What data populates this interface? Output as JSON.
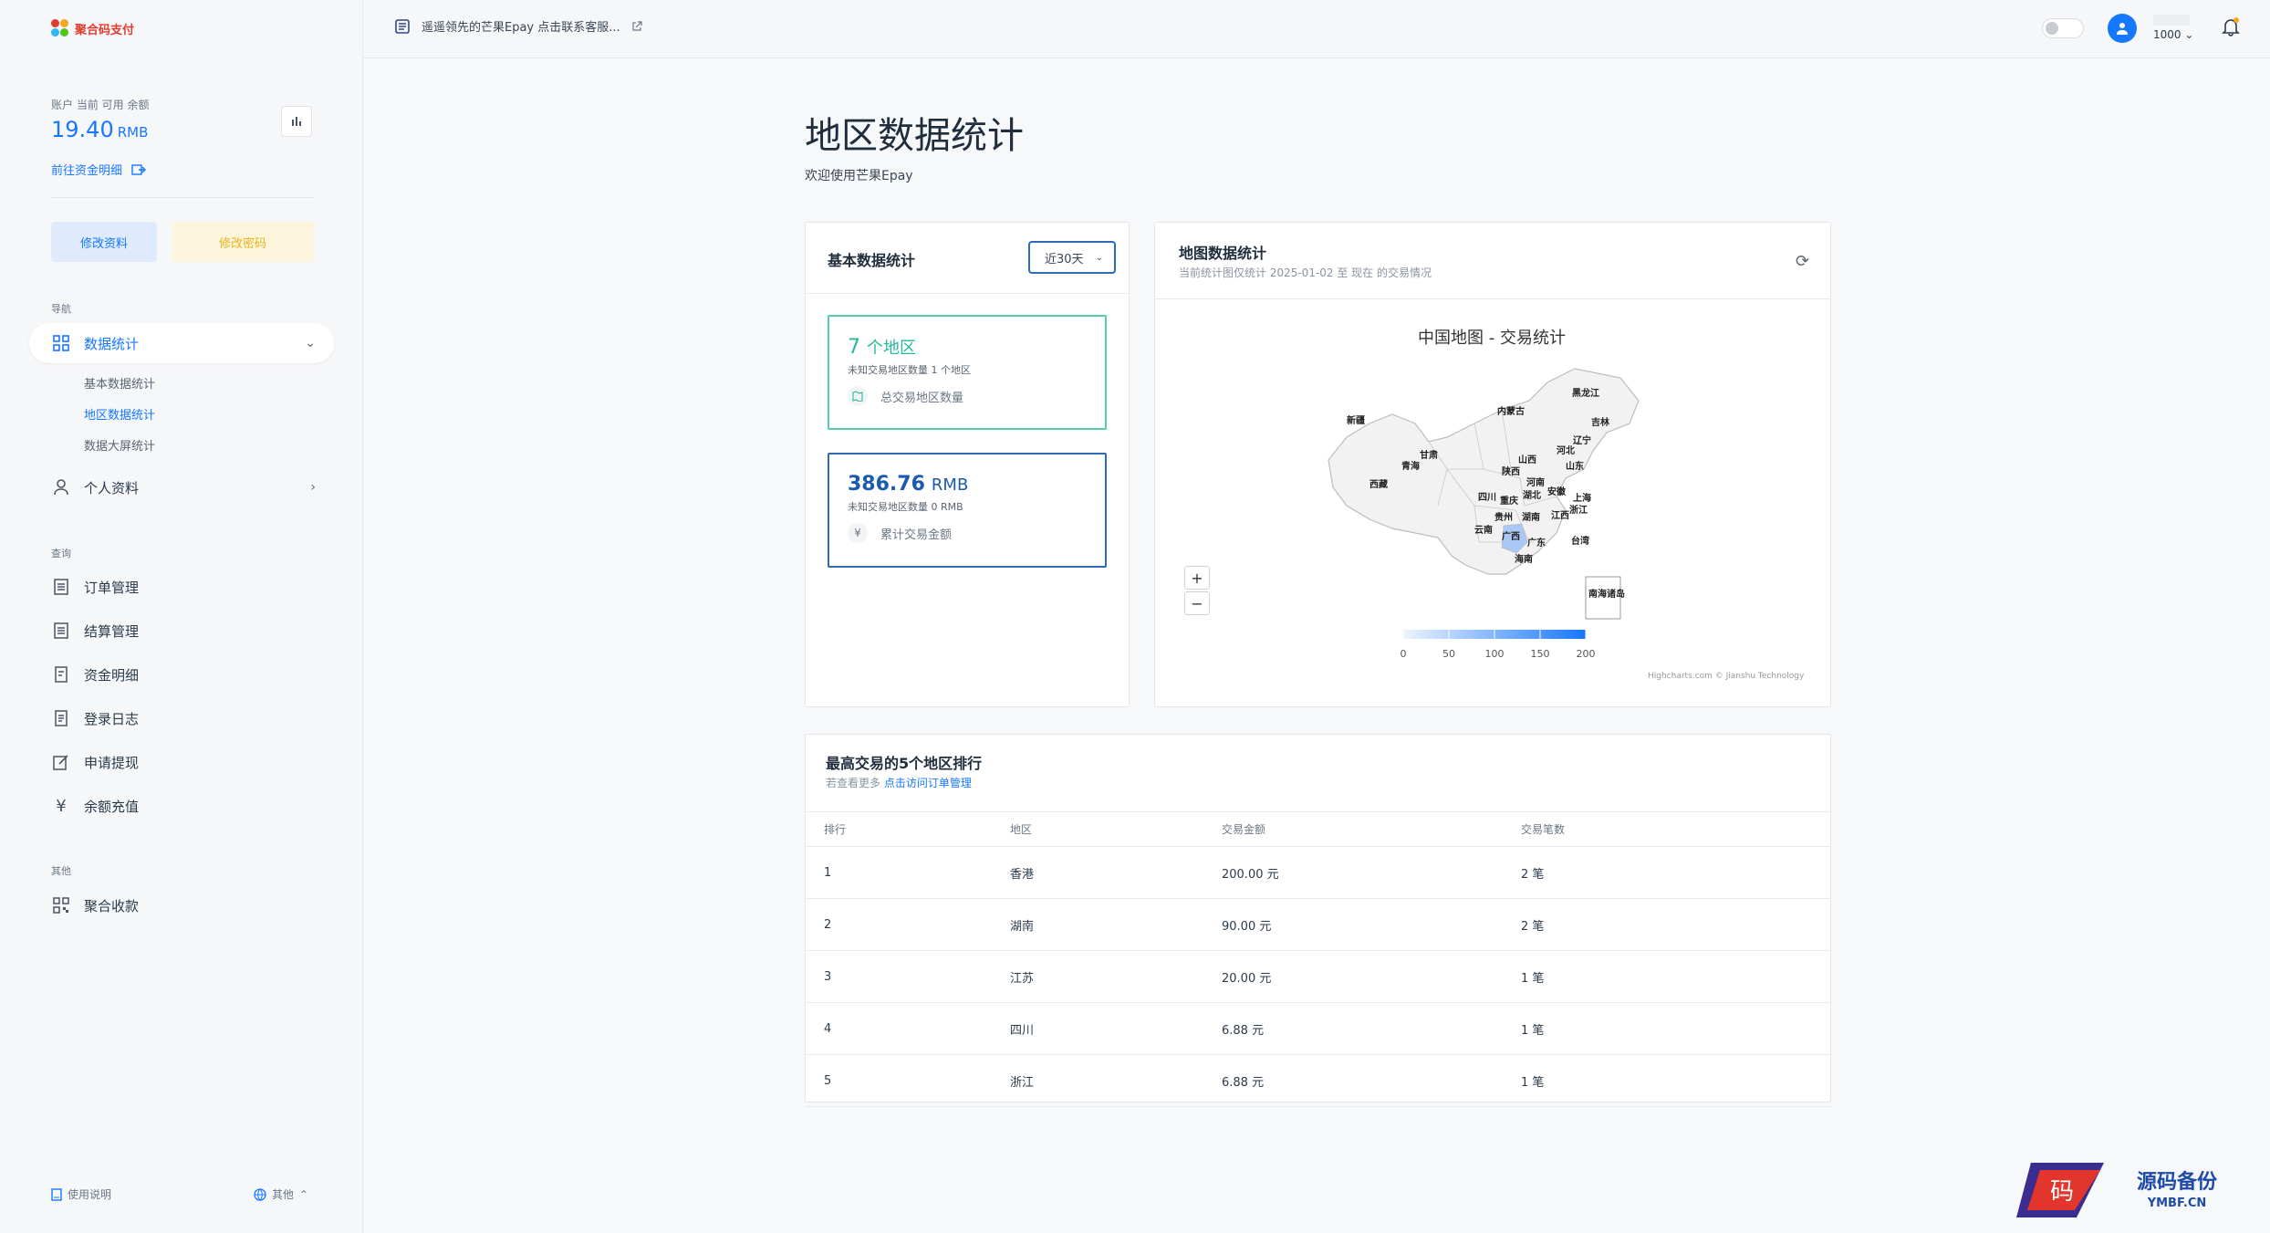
{
  "brand": {
    "name": "聚合码支付"
  },
  "sidebar": {
    "balance_caption": "账户 当前 可用 余额",
    "balance_value": "19.40",
    "balance_unit": "RMB",
    "fund_link": "前往资金明细",
    "btn_profile": "修改资料",
    "btn_password": "修改密码",
    "section_nav": "导航",
    "section_query": "查询",
    "section_other": "其他",
    "nav_stats": "数据统计",
    "sub_basic": "基本数据统计",
    "sub_region": "地区数据统计",
    "sub_screen": "数据大屏统计",
    "nav_profile": "个人资料",
    "nav_orders": "订单管理",
    "nav_settle": "结算管理",
    "nav_funds": "资金明细",
    "nav_login_log": "登录日志",
    "nav_withdraw": "申请提现",
    "nav_recharge": "余额充值",
    "nav_aggregate": "聚合收款",
    "foot_help": "使用说明",
    "foot_lang": "其他"
  },
  "topbar": {
    "notice": "遥遥领先的芒果Epay 点击联系客服...",
    "user_name": "1000"
  },
  "page": {
    "title": "地区数据统计",
    "subtitle": "欢迎使用芒果Epay"
  },
  "basic_card": {
    "title": "基本数据统计",
    "range": "近30天",
    "box1_value": "7",
    "box1_unit": "个地区",
    "box1_line": "未知交易地区数量 1 个地区",
    "box1_foot": "总交易地区数量",
    "box2_value": "386.76",
    "box2_unit": "RMB",
    "box2_line": "未知交易地区数量 0 RMB",
    "box2_foot": "累计交易金额",
    "currency_symbol": "¥"
  },
  "map_card": {
    "title": "地图数据统计",
    "subtitle": "当前统计图仅统计 2025-01-02 至 现在 的交易情况",
    "map_title": "中国地图 - 交易统计",
    "zoom_in": "+",
    "zoom_out": "−",
    "legend_ticks": [
      "0",
      "50",
      "100",
      "150",
      "200"
    ],
    "credits": "Highcharts.com © Jianshu Technology",
    "province_labels": [
      {
        "name": "黑龙江"
      },
      {
        "name": "吉林"
      },
      {
        "name": "辽宁"
      },
      {
        "name": "内蒙古"
      },
      {
        "name": "新疆"
      },
      {
        "name": "甘肃"
      },
      {
        "name": "青海"
      },
      {
        "name": "河北"
      },
      {
        "name": "山西"
      },
      {
        "name": "山东"
      },
      {
        "name": "陕西"
      },
      {
        "name": "河南"
      },
      {
        "name": "西藏"
      },
      {
        "name": "四川"
      },
      {
        "name": "重庆"
      },
      {
        "name": "湖北"
      },
      {
        "name": "安徽"
      },
      {
        "name": "上海"
      },
      {
        "name": "浙江"
      },
      {
        "name": "江西"
      },
      {
        "name": "湖南"
      },
      {
        "name": "贵州"
      },
      {
        "name": "云南"
      },
      {
        "name": "广西"
      },
      {
        "name": "广东"
      },
      {
        "name": "台湾"
      },
      {
        "name": "海南"
      },
      {
        "name": "南海诸岛"
      }
    ],
    "colors": {
      "low": "#eef4fe",
      "high": "#1677ff"
    }
  },
  "chart_data": {
    "type": "heatmap",
    "title": "中国地图 - 交易统计",
    "color_axis": [
      0,
      200
    ],
    "regions": [
      "香港",
      "湖南",
      "江苏",
      "四川",
      "浙江"
    ],
    "values": [
      200.0,
      90.0,
      20.0,
      6.88,
      6.88
    ]
  },
  "rank_card": {
    "title": "最高交易的5个地区排行",
    "subtitle": "若查看更多",
    "subtitle_link": "点击访问订单管理",
    "columns": [
      "排行",
      "地区",
      "交易金额",
      "交易笔数"
    ],
    "rows": [
      [
        "1",
        "香港",
        "200.00 元",
        "2 笔"
      ],
      [
        "2",
        "湖南",
        "90.00 元",
        "2 笔"
      ],
      [
        "3",
        "江苏",
        "20.00 元",
        "1 笔"
      ],
      [
        "4",
        "四川",
        "6.88 元",
        "1 笔"
      ],
      [
        "5",
        "浙江",
        "6.88 元",
        "1 笔"
      ]
    ]
  },
  "watermark": {
    "glyph": "码",
    "title": "源码备份",
    "url": "YMBF.CN"
  }
}
